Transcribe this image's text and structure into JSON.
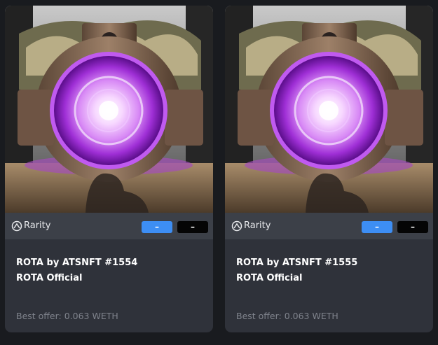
{
  "cards": [
    {
      "image_icon": "portal-nft-artwork",
      "rarity_label": "Rarity",
      "rarity_icon": "rarity-gauge-icon",
      "rank_blue": "–",
      "rank_black": "–",
      "name": "ROTA by ATSNFT #1554",
      "collection": "ROTA Official",
      "offer": "Best offer: 0.063 WETH"
    },
    {
      "image_icon": "portal-nft-artwork",
      "rarity_label": "Rarity",
      "rarity_icon": "rarity-gauge-icon",
      "rank_blue": "–",
      "rank_black": "–",
      "name": "ROTA by ATSNFT #1555",
      "collection": "ROTA Official",
      "offer": "Best offer: 0.063 WETH"
    }
  ],
  "colors": {
    "page_bg": "#191b1f",
    "card_bg": "#2f323a",
    "rarity_bar_bg": "#3c4048",
    "accent_blue": "#3d8ef4",
    "badge_black": "#050505",
    "muted_text": "#7f838c",
    "portal_purple": "#b53ee8"
  }
}
